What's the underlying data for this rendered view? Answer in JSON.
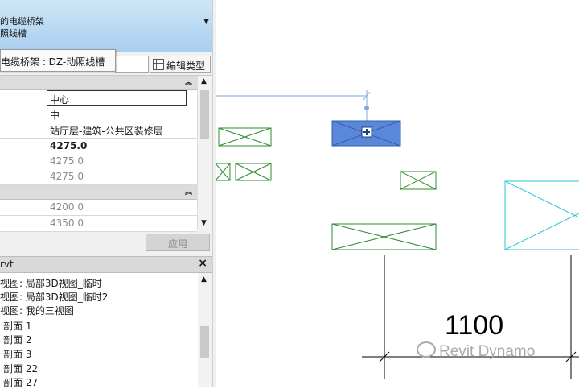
{
  "type_selector": {
    "family": "的电缆桥架",
    "type": "照线槽",
    "dropdown_icon": "caret-down"
  },
  "tooltip": {
    "text": "电缆桥架 : DZ-动照线槽"
  },
  "toolbar": {
    "edit_type_label": "编辑类型"
  },
  "properties": {
    "rows_group1": [
      "中心",
      "中",
      "站厅层-建筑-公共区装修层",
      "4275.0",
      "4275.0",
      "4275.0"
    ],
    "rows_group2": [
      "4200.0",
      "4350.0",
      ""
    ],
    "apply_label": "应用"
  },
  "project_browser": {
    "title": "rvt",
    "items": [
      "视图: 局部3D视图_临时",
      "视图: 局部3D视图_临时2",
      "视图: 我的三视图",
      "剖面 1",
      "剖面 2",
      "剖面 3",
      "剖面 22",
      "剖面 27"
    ]
  },
  "canvas": {
    "dimension_value": "1100",
    "watermark": "Revit Dynamo"
  },
  "colors": {
    "selection": "#5b87d8",
    "tray_green": "#2e8b2e",
    "cyan_box": "#28c4d4",
    "blue_line": "#7aa9d8"
  }
}
